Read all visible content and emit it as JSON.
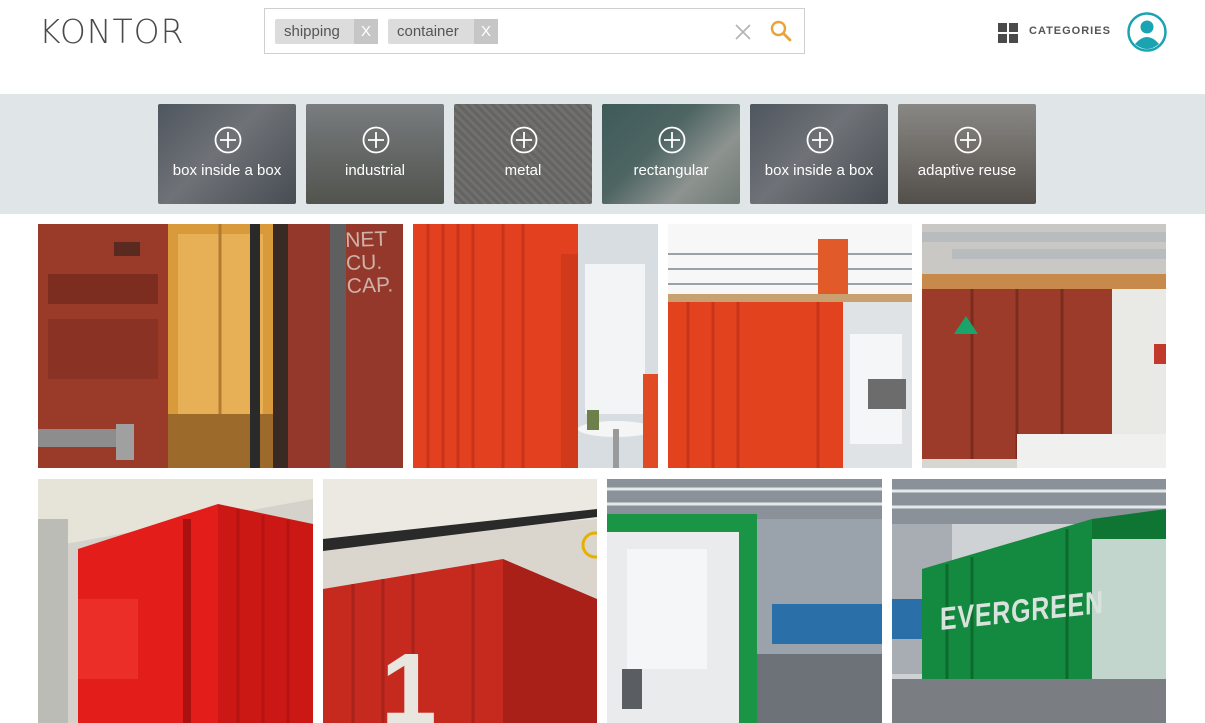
{
  "header": {
    "logo": "KONTOR",
    "search": {
      "chips": [
        {
          "label": "shipping",
          "remove": "X"
        },
        {
          "label": "container",
          "remove": "X"
        }
      ]
    },
    "categories_label": "CATEGORIES"
  },
  "suggestions": [
    {
      "label": "box inside a box"
    },
    {
      "label": "industrial"
    },
    {
      "label": "metal"
    },
    {
      "label": "rectangular"
    },
    {
      "label": "box inside a box"
    },
    {
      "label": "adaptive reuse"
    }
  ],
  "photos": [
    {
      "name": "red-container-door-closeup"
    },
    {
      "name": "orange-container-office"
    },
    {
      "name": "orange-container-mezzanine"
    },
    {
      "name": "rusty-red-container-hyundai"
    },
    {
      "name": "red-container-corner"
    },
    {
      "name": "red-container-number-1"
    },
    {
      "name": "green-container-interior"
    },
    {
      "name": "green-evergreen-container"
    }
  ],
  "photo_text": {
    "net_cu_cap": [
      "NET",
      "CU. CAP."
    ],
    "number_one": "1",
    "evergreen": "EVERGREEN"
  },
  "colors": {
    "accent_orange": "#e8a33a",
    "avatar_teal": "#1aa3b0",
    "strip_bg": "#e0e5e8"
  }
}
